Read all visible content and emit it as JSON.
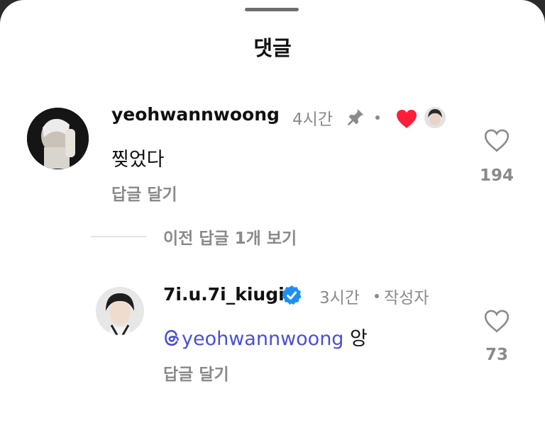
{
  "sheet": {
    "title": "댓글"
  },
  "comments": [
    {
      "username": "yeohwannwoong",
      "time": "4시간",
      "text": "찢었다",
      "reply_label": "답글 달기",
      "like_count": "194",
      "pinned": true,
      "liked_by_creator": true
    }
  ],
  "thread": {
    "view_previous_label": "이전 답글 1개 보기"
  },
  "replies": [
    {
      "username": "7i.u.7i_kiugi",
      "verified": true,
      "time": "3시간",
      "author_badge": "작성자",
      "mention": "yeohwannwoong",
      "text": "앙",
      "reply_label": "답글 달기",
      "like_count": "73"
    }
  ],
  "colors": {
    "accent_heart": "#ff1e3a",
    "verified_badge": "#1d8ff2",
    "mention": "#4a4fd8",
    "muted_text": "#8a8a8a"
  }
}
